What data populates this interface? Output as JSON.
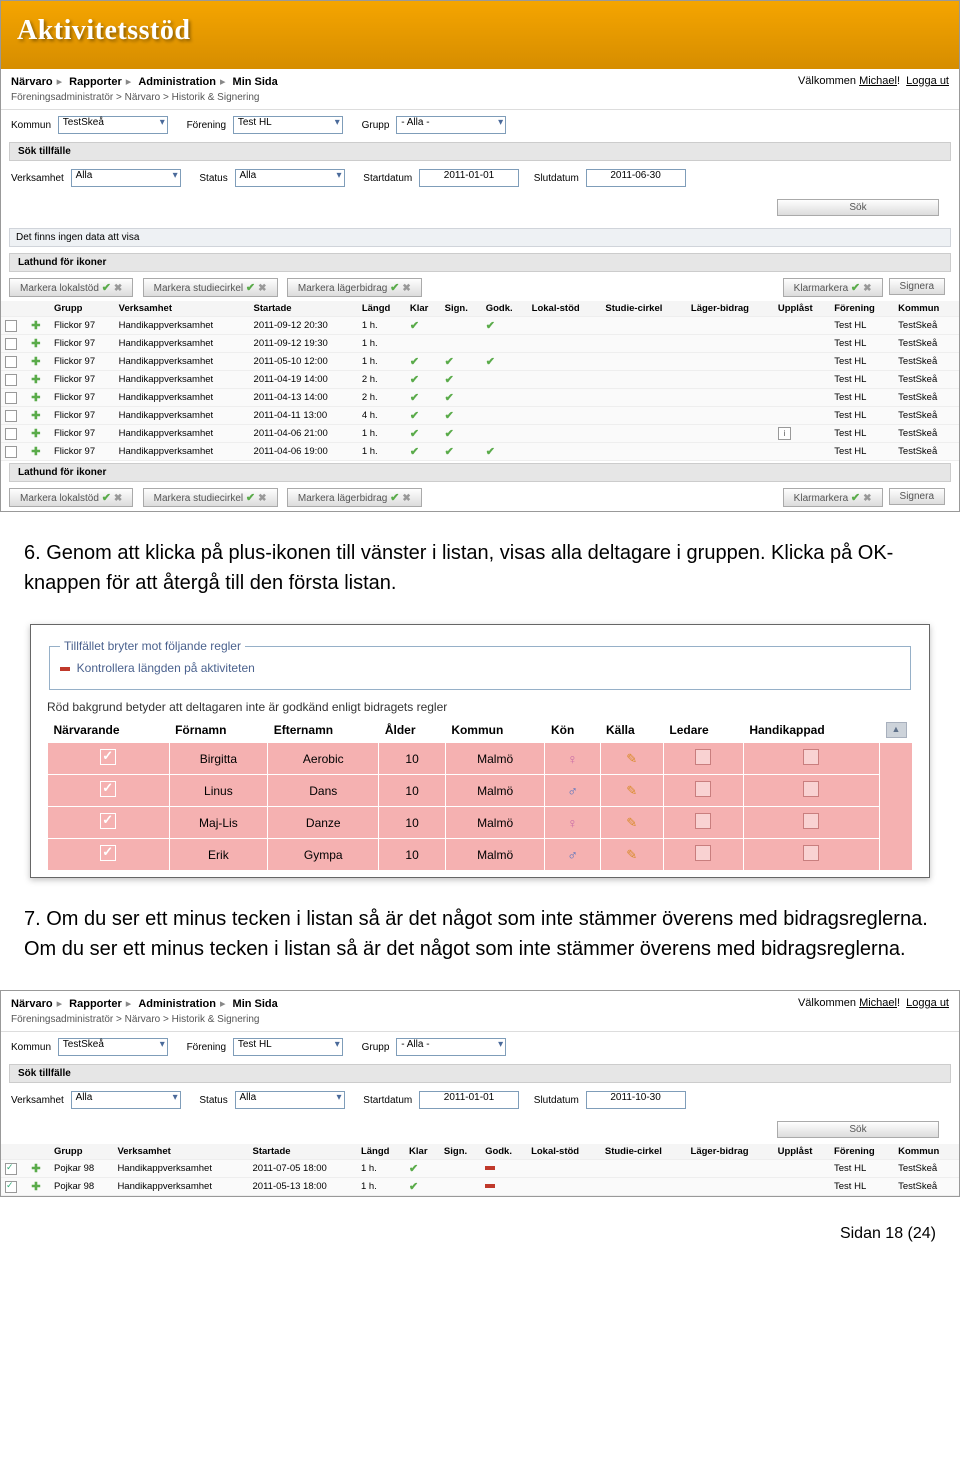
{
  "app_title": "Aktivitetsstöd",
  "nav": {
    "items": [
      "Närvaro",
      "Rapporter",
      "Administration",
      "Min Sida"
    ]
  },
  "welcome": {
    "prefix": "Välkommen ",
    "user": "Michael",
    "bang": "!",
    "logout": "Logga ut"
  },
  "breadcrumb1": "Föreningsadministratör > Närvaro > Historik & Signering",
  "filters1": {
    "kommun_label": "Kommun",
    "kommun_val": "TestSkeå",
    "forening_label": "Förening",
    "forening_val": "Test HL",
    "grupp_label": "Grupp",
    "grupp_val": "- Alla -"
  },
  "section1": "Sök tillfälle",
  "filters2": {
    "verksamhet_label": "Verksamhet",
    "verksamhet_val": "Alla",
    "status_label": "Status",
    "status_val": "Alla",
    "start_label": "Startdatum",
    "start_val": "2011-01-01",
    "slut_label": "Slutdatum",
    "slut_val_a": "2011-06-30",
    "slut_val_b": "2011-10-30",
    "sok_btn": "Sök"
  },
  "nodata": "Det finns ingen data att visa",
  "section2": "Lathund för ikoner",
  "toolbar": {
    "lokalstod": "Markera lokalstöd",
    "studiecirkel": "Markera studiecirkel",
    "lagerbidrag": "Markera lägerbidrag",
    "klarmarkera": "Klarmarkera",
    "signera": "Signera"
  },
  "grid1_headers": [
    "",
    "",
    "Grupp",
    "Verksamhet",
    "Startade",
    "Längd",
    "Klar",
    "Sign.",
    "Godk.",
    "Lokal-stöd",
    "Studie-cirkel",
    "Läger-bidrag",
    "Upplåst",
    "Förening",
    "Kommun"
  ],
  "grid1_rows": [
    {
      "grupp": "Flickor 97",
      "verksamhet": "Handikappverksamhet",
      "start": "2011-09-12 20:30",
      "langd": "1 h.",
      "klar": true,
      "sign": false,
      "godk": true,
      "info": false
    },
    {
      "grupp": "Flickor 97",
      "verksamhet": "Handikappverksamhet",
      "start": "2011-09-12 19:30",
      "langd": "1 h.",
      "klar": false,
      "sign": false,
      "godk": false,
      "info": false
    },
    {
      "grupp": "Flickor 97",
      "verksamhet": "Handikappverksamhet",
      "start": "2011-05-10 12:00",
      "langd": "1 h.",
      "klar": true,
      "sign": true,
      "godk": true,
      "info": false
    },
    {
      "grupp": "Flickor 97",
      "verksamhet": "Handikappverksamhet",
      "start": "2011-04-19 14:00",
      "langd": "2 h.",
      "klar": true,
      "sign": true,
      "godk": false,
      "info": false
    },
    {
      "grupp": "Flickor 97",
      "verksamhet": "Handikappverksamhet",
      "start": "2011-04-13 14:00",
      "langd": "2 h.",
      "klar": true,
      "sign": true,
      "godk": false,
      "info": false
    },
    {
      "grupp": "Flickor 97",
      "verksamhet": "Handikappverksamhet",
      "start": "2011-04-11 13:00",
      "langd": "4 h.",
      "klar": true,
      "sign": true,
      "godk": false,
      "info": false
    },
    {
      "grupp": "Flickor 97",
      "verksamhet": "Handikappverksamhet",
      "start": "2011-04-06 21:00",
      "langd": "1 h.",
      "klar": true,
      "sign": true,
      "godk": false,
      "info": true
    },
    {
      "grupp": "Flickor 97",
      "verksamhet": "Handikappverksamhet",
      "start": "2011-04-06 19:00",
      "langd": "1 h.",
      "klar": true,
      "sign": true,
      "godk": true,
      "info": false
    }
  ],
  "grid_forening": "Test HL",
  "grid_kommun": "TestSkeå",
  "para6": "6. Genom att klicka på plus-ikonen till vänster i listan, visas alla deltagare i gruppen. Klicka på OK-knappen för att återgå till den första listan.",
  "rules": {
    "legend": "Tillfället bryter mot följande regler",
    "line1": "Kontrollera längden på aktiviteten",
    "red_text": "Röd bakgrund betyder att deltagaren inte är godkänd enligt bidragets regler",
    "headers": [
      "Närvarande",
      "Förnamn",
      "Efternamn",
      "Ålder",
      "Kommun",
      "Kön",
      "Källa",
      "Ledare",
      "Handikappad"
    ],
    "rows": [
      {
        "fornamn": "Birgitta",
        "efternamn": "Aerobic",
        "alder": "10",
        "kommun": "Malmö",
        "kon": "f"
      },
      {
        "fornamn": "Linus",
        "efternamn": "Dans",
        "alder": "10",
        "kommun": "Malmö",
        "kon": "m"
      },
      {
        "fornamn": "Maj-Lis",
        "efternamn": "Danze",
        "alder": "10",
        "kommun": "Malmö",
        "kon": "f"
      },
      {
        "fornamn": "Erik",
        "efternamn": "Gympa",
        "alder": "10",
        "kommun": "Malmö",
        "kon": "m"
      }
    ]
  },
  "para7": "7. Om du ser ett minus tecken i listan så är det något som inte stämmer överens med bidragsreglerna. Om du ser ett minus tecken i listan så är det något som inte stämmer överens med bidragsreglerna.",
  "grid2_headers": [
    "",
    "",
    "Grupp",
    "Verksamhet",
    "Startade",
    "Längd",
    "Klar",
    "Sign.",
    "Godk.",
    "Lokal-stöd",
    "Studie-cirkel",
    "Läger-bidrag",
    "Upplåst",
    "Förening",
    "Kommun"
  ],
  "grid2_rows": [
    {
      "grupp": "Pojkar 98",
      "verksamhet": "Handikappverksamhet",
      "start": "2011-07-05 18:00",
      "langd": "1 h.",
      "klar": true,
      "godk": "minus"
    },
    {
      "grupp": "Pojkar 98",
      "verksamhet": "Handikappverksamhet",
      "start": "2011-05-13 18:00",
      "langd": "1 h.",
      "klar": true,
      "godk": "minus"
    }
  ],
  "footer": "Sidan 18 (24)"
}
